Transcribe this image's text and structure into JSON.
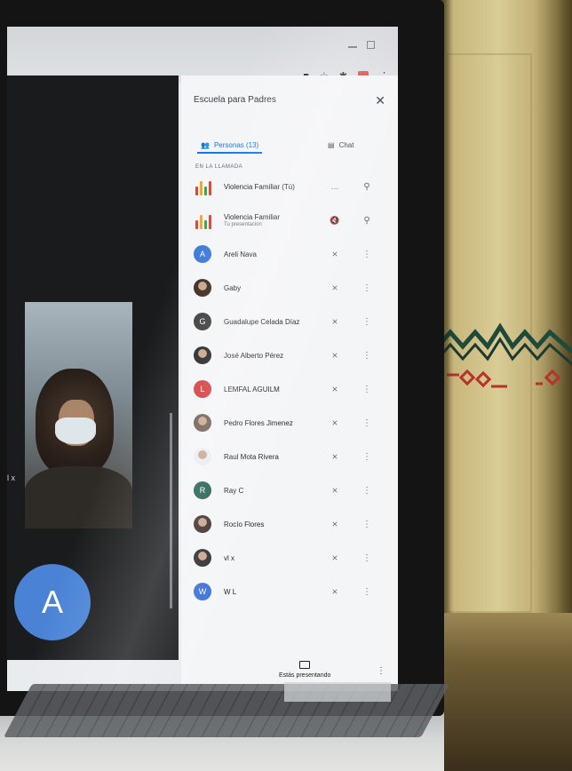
{
  "panel": {
    "title": "Escuela para Padres",
    "tab_people": "Personas (13)",
    "tab_chat": "Chat",
    "section": "EN LA LLAMADA"
  },
  "participants": [
    {
      "name": "Violencia Familiar (Tú)",
      "sub": "",
      "avatar": "logo",
      "mic": "…",
      "action": "pin-icon"
    },
    {
      "name": "Violencia Familiar",
      "sub": "Tu presentación",
      "avatar": "logo",
      "mic": "speaker-off-icon",
      "action": "pin-icon"
    },
    {
      "name": "Areli Nava",
      "sub": "",
      "avatar": "A",
      "color": "#3b78d8",
      "mic": "mic-off-icon",
      "action": "more-icon"
    },
    {
      "name": "Gaby",
      "sub": "",
      "avatar": "photo",
      "color": "#3a2a20",
      "mic": "mic-off-icon",
      "action": "more-icon"
    },
    {
      "name": "Guadalupe Celada Díaz",
      "sub": "",
      "avatar": "G",
      "color": "#3b3b3b",
      "mic": "mic-off-icon",
      "action": "more-icon"
    },
    {
      "name": "José Alberto Pérez",
      "sub": "",
      "avatar": "photo",
      "color": "#222222",
      "mic": "mic-off-icon",
      "action": "more-icon"
    },
    {
      "name": "LEMFAL AGUILM",
      "sub": "",
      "avatar": "L",
      "color": "#d23a3a",
      "mic": "mic-off-icon",
      "action": "more-icon"
    },
    {
      "name": "Pedro Flores Jimenez",
      "sub": "",
      "avatar": "photo",
      "color": "#6a5a50",
      "mic": "mic-off-icon",
      "action": "more-icon"
    },
    {
      "name": "Raul Mota Rivera",
      "sub": "",
      "avatar": "photo",
      "color": "#e9ecef",
      "mic": "mic-off-icon",
      "action": "more-icon"
    },
    {
      "name": "Ray C",
      "sub": "",
      "avatar": "R",
      "color": "#1f5c4f",
      "mic": "mic-off-icon",
      "action": "more-icon"
    },
    {
      "name": "Rocío Flores",
      "sub": "",
      "avatar": "photo",
      "color": "#3b2f2a",
      "mic": "mic-off-icon",
      "action": "more-icon"
    },
    {
      "name": "vl x",
      "sub": "",
      "avatar": "photo",
      "color": "#2c2c2c",
      "mic": "mic-off-icon",
      "action": "more-icon"
    },
    {
      "name": "W L",
      "sub": "",
      "avatar": "W",
      "color": "#3b6fd6",
      "mic": "mic-off-icon",
      "action": "more-icon"
    }
  ],
  "bottom": {
    "present_label": "Estás presentando"
  },
  "video": {
    "avatar_letter": "A",
    "partial_text": "l x"
  },
  "colors": {
    "accent": "#1a73e8",
    "panel_bg": "#f4f5f7"
  }
}
